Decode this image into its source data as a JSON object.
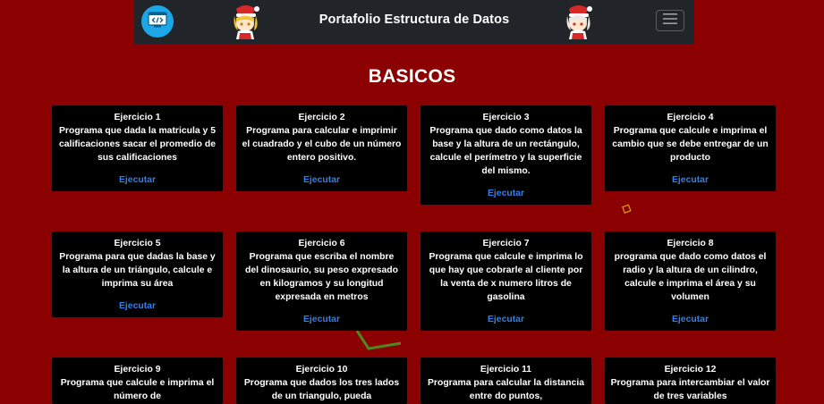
{
  "navbar": {
    "title": "Portafolio Estructura de Datos",
    "logo_icon": "code-window-icon",
    "menu_icon": "hamburger-menu-icon",
    "mascot_icon": "anime-santa-mascot-icon"
  },
  "section": {
    "heading": "BASICOS"
  },
  "cards": [
    {
      "title": "Ejercicio 1",
      "description": "Programa que dada la matricula y 5 calificaciones sacar el promedio de sus calificaciones",
      "action": "Ejecutar"
    },
    {
      "title": "Ejercicio 2",
      "description": "Programa para calcular e imprimir el cuadrado y el cubo de un número entero positivo.",
      "action": "Ejecutar"
    },
    {
      "title": "Ejercicio 3",
      "description": "Programa que dado como datos la base y la altura de un rectángulo, calcule el perímetro y la superficie del mismo.",
      "action": "Ejecutar"
    },
    {
      "title": "Ejercicio 4",
      "description": "Programa que calcule e imprima el cambio que se debe entregar de un producto",
      "action": "Ejecutar"
    },
    {
      "title": "Ejercicio 5",
      "description": "Programa para que dadas la base y la altura de un triángulo, calcule e imprima su área",
      "action": "Ejecutar"
    },
    {
      "title": "Ejercicio 6",
      "description": "Programa que escriba el nombre del dinosaurio, su peso expresado en kilogramos y su longitud expresada en metros",
      "action": "Ejecutar"
    },
    {
      "title": "Ejercicio 7",
      "description": "Programa que calcule e imprima lo que hay que cobrarle al cliente por la venta de x numero litros de gasolina",
      "action": "Ejecutar"
    },
    {
      "title": "Ejercicio 8",
      "description": "programa que dado como datos el radio y la altura de un cilindro, calcule e imprima el área y su volumen",
      "action": "Ejecutar"
    },
    {
      "title": "Ejercicio 9",
      "description": "Programa que calcule e imprima el número de",
      "action": ""
    },
    {
      "title": "Ejercicio 10",
      "description": "Programa que dados los tres lados de un triangulo, pueda",
      "action": ""
    },
    {
      "title": "Ejercicio 11",
      "description": "Programa para calcular la distancia entre do puntos,",
      "action": ""
    },
    {
      "title": "Ejercicio 12",
      "description": "Programa para intercambiar el valor de tres variables",
      "action": ""
    }
  ],
  "colors": {
    "page_background": "#8b0000",
    "navbar_background": "#212529",
    "card_background": "#000000",
    "link": "#2f80ed",
    "logo_badge": "#1ca7e8",
    "decoration_green": "#4c8a1e",
    "decoration_yellow": "#d4a017"
  }
}
